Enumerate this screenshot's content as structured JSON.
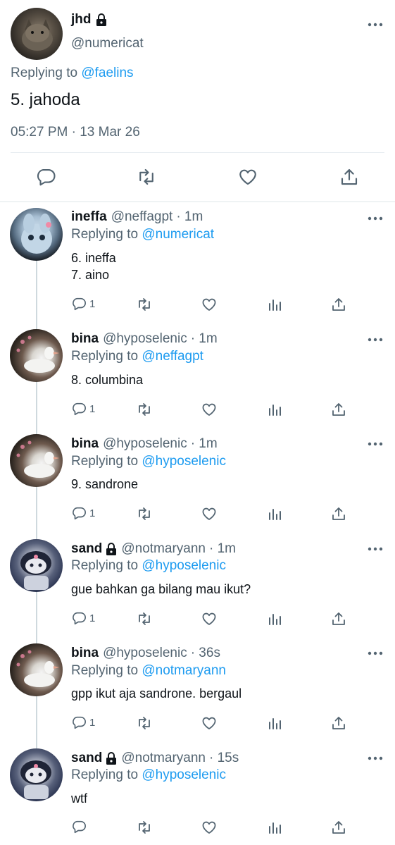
{
  "main_tweet": {
    "name": "jhd",
    "handle": "@numericat",
    "replying_label": "Replying to",
    "replying_to": "@faelins",
    "text": "5. jahoda",
    "timestamp": "05:27 PM · 13 Mar 26",
    "protected": true
  },
  "replies": [
    {
      "name": "ineffa",
      "handle": "@neffagpt",
      "time": "· 1m",
      "replying_label": "Replying to",
      "replying_to": "@numericat",
      "lines": [
        "6. ineffa",
        "7. aino"
      ],
      "reply_count": "1",
      "protected": false
    },
    {
      "name": "bina",
      "handle": "@hyposelenic",
      "time": "· 1m",
      "replying_label": "Replying to",
      "replying_to": "@neffagpt",
      "lines": [
        "8. columbina"
      ],
      "reply_count": "1",
      "protected": false
    },
    {
      "name": "bina",
      "handle": "@hyposelenic",
      "time": "· 1m",
      "replying_label": "Replying to",
      "replying_to": "@hyposelenic",
      "lines": [
        "9. sandrone"
      ],
      "reply_count": "1",
      "protected": false
    },
    {
      "name": "sand",
      "handle": "@notmaryann",
      "time": "· 1m",
      "replying_label": "Replying to",
      "replying_to": "@hyposelenic",
      "lines": [
        "gue bahkan ga bilang mau ikut?"
      ],
      "reply_count": "1",
      "protected": true
    },
    {
      "name": "bina",
      "handle": "@hyposelenic",
      "time": "· 36s",
      "replying_label": "Replying to",
      "replying_to": "@notmaryann",
      "lines": [
        "gpp ikut aja sandrone. bergaul"
      ],
      "reply_count": "1",
      "protected": false
    },
    {
      "name": "sand",
      "handle": "@notmaryann",
      "time": "· 15s",
      "replying_label": "Replying to",
      "replying_to": "@hyposelenic",
      "lines": [
        "wtf"
      ],
      "reply_count": "",
      "protected": true
    }
  ],
  "icons": {
    "reply": "reply-icon",
    "retweet": "retweet-icon",
    "like": "like-icon",
    "views": "views-icon",
    "share": "share-icon",
    "more": "more-icon",
    "lock": "lock-icon"
  },
  "colors": {
    "link": "#1d9bf0",
    "secondary_text": "#536471",
    "primary_text": "#0f1419"
  }
}
